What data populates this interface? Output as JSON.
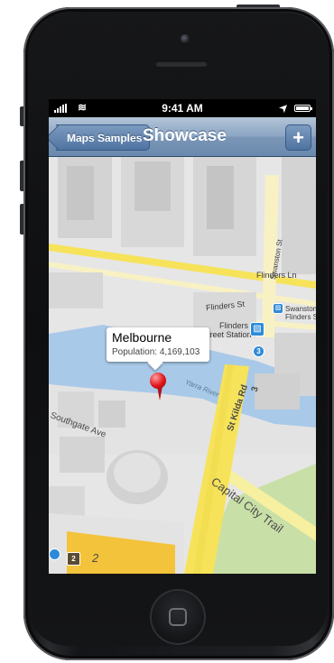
{
  "status_bar": {
    "time": "9:41 AM",
    "signal_icon": "signal-bars-icon",
    "wifi_icon": "wifi-icon",
    "location_icon": "location-arrow-icon",
    "battery_icon": "battery-icon"
  },
  "nav_bar": {
    "back_label": "Maps Samples",
    "title": "Showcase",
    "add_label": "+"
  },
  "map": {
    "callout": {
      "title": "Melbourne",
      "subtitle": "Population: 4,169,103"
    },
    "pin_icon": "red-map-pin-icon",
    "labels": {
      "flinders_ln": "Flinders Ln",
      "flinders_st": "Flinders St",
      "swanston_st": "Swanston St",
      "swanston": "Swanston",
      "flinders_s": "Flinders S",
      "station_1": "Flinders",
      "station_2": "Street Station",
      "st_kilda_rd": "St Kilda Rd",
      "capital_city_trail": "Capital City Trail",
      "yarra_river": "Yarra River",
      "southgate_ave": "Southgate Ave",
      "route_3_a": "3",
      "route_3_b": "3",
      "route_2_badge": "2",
      "route_2_text": "2"
    },
    "colors": {
      "water": "#a9c9e8",
      "major_road": "#f6e35a",
      "land": "#e6e6e6",
      "park": "#c9dfa8"
    }
  }
}
